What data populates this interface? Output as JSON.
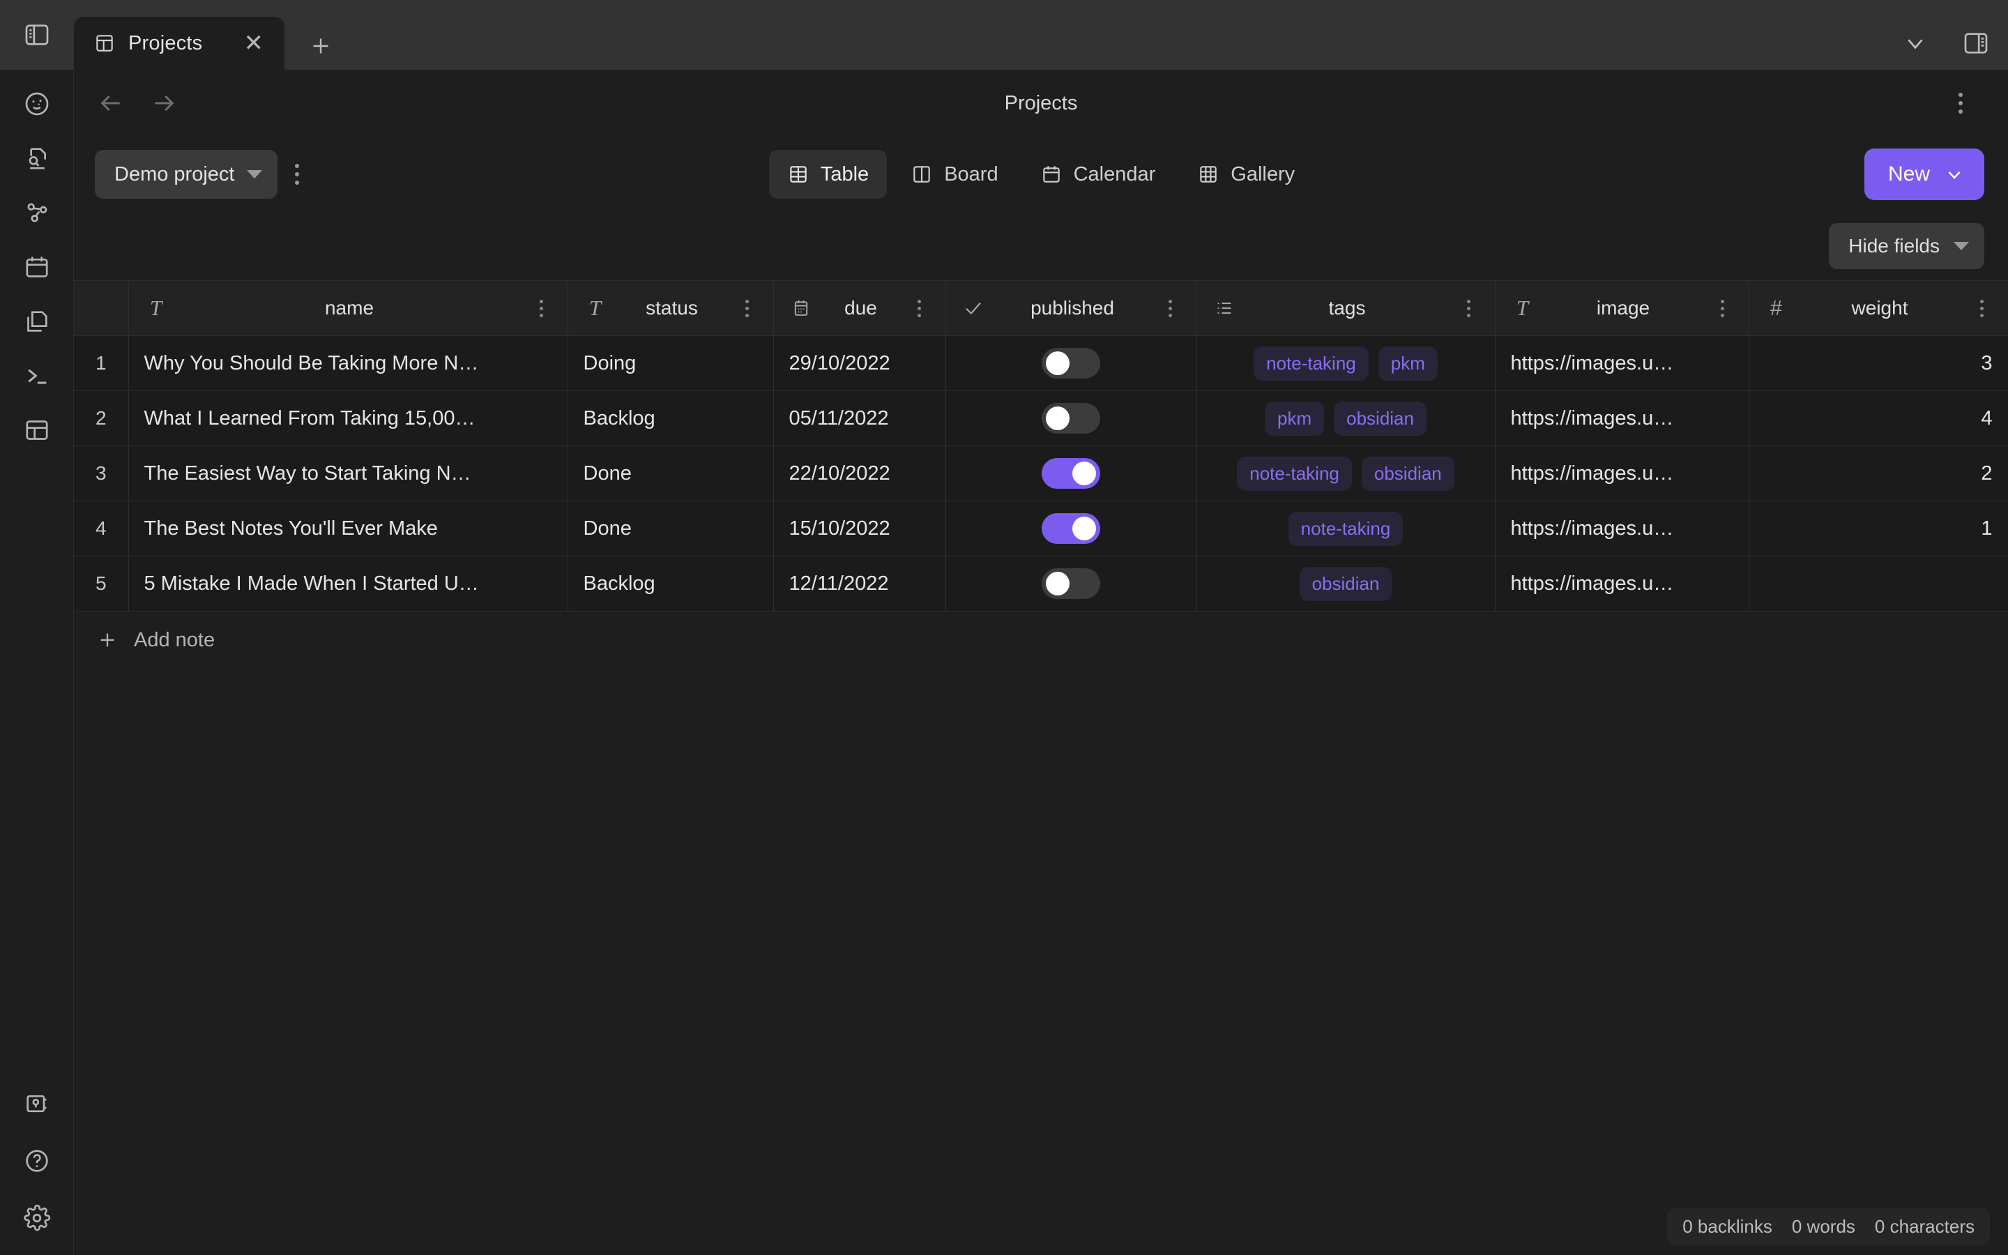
{
  "titlebar": {
    "sidebar_toggle_icon": "sidebar-left-icon",
    "tab": {
      "icon": "table-view-icon",
      "label": "Projects",
      "close_icon": "close-icon"
    },
    "new_tab_icon": "plus-icon",
    "chevron_icon": "chevron-down-icon",
    "right_sidebar_icon": "sidebar-right-icon"
  },
  "ribbon": {
    "top_items": [
      {
        "name": "sidebar-item-face",
        "icon": "smiley-face-icon"
      },
      {
        "name": "sidebar-item-search",
        "icon": "file-search-icon"
      },
      {
        "name": "sidebar-item-graph",
        "icon": "graph-nodes-icon"
      },
      {
        "name": "sidebar-item-calendar",
        "icon": "calendar-icon"
      },
      {
        "name": "sidebar-item-copy",
        "icon": "copy-files-icon"
      },
      {
        "name": "sidebar-item-terminal",
        "icon": "terminal-icon"
      },
      {
        "name": "sidebar-item-layout",
        "icon": "layout-panels-icon"
      }
    ],
    "bottom_items": [
      {
        "name": "sidebar-item-vault",
        "icon": "vault-icon"
      },
      {
        "name": "sidebar-item-help",
        "icon": "question-circle-icon"
      },
      {
        "name": "sidebar-item-settings",
        "icon": "gear-icon"
      }
    ]
  },
  "view_header": {
    "back_icon": "arrow-left-icon",
    "forward_icon": "arrow-right-icon",
    "title": "Projects",
    "more_icon": "kebab-vertical-icon"
  },
  "toolbar": {
    "project_label": "Demo project",
    "project_caret_icon": "caret-down-icon",
    "more_icon": "kebab-vertical-icon",
    "views": [
      {
        "label": "Table",
        "icon": "table-grid-icon",
        "active": true
      },
      {
        "label": "Board",
        "icon": "board-columns-icon",
        "active": false
      },
      {
        "label": "Calendar",
        "icon": "calendar-icon",
        "active": false
      },
      {
        "label": "Gallery",
        "icon": "gallery-grid-icon",
        "active": false
      }
    ],
    "new_label": "New",
    "new_chevron_icon": "chevron-down-icon",
    "new_button_color": "#7c5cf0"
  },
  "fieldbar": {
    "hide_fields_label": "Hide fields",
    "hide_fields_caret_icon": "caret-down-icon"
  },
  "table": {
    "columns": [
      {
        "key": "idx",
        "label": "",
        "type_icon": ""
      },
      {
        "key": "name",
        "label": "name",
        "type_icon": "text-type-icon"
      },
      {
        "key": "status",
        "label": "status",
        "type_icon": "text-type-icon"
      },
      {
        "key": "due",
        "label": "due",
        "type_icon": "calendar-type-icon"
      },
      {
        "key": "published",
        "label": "published",
        "type_icon": "checkbox-type-icon"
      },
      {
        "key": "tags",
        "label": "tags",
        "type_icon": "list-type-icon"
      },
      {
        "key": "image",
        "label": "image",
        "type_icon": "text-type-icon"
      },
      {
        "key": "weight",
        "label": "weight",
        "type_icon": "number-type-icon"
      }
    ],
    "rows": [
      {
        "idx": "1",
        "name": "Why You Should Be Taking More N…",
        "status": "Doing",
        "due": "29/10/2022",
        "published": false,
        "tags": [
          "note-taking",
          "pkm"
        ],
        "image": "https://images.u…",
        "weight": "3"
      },
      {
        "idx": "2",
        "name": "What I Learned From Taking 15,00…",
        "status": "Backlog",
        "due": "05/11/2022",
        "published": false,
        "tags": [
          "pkm",
          "obsidian"
        ],
        "image": "https://images.u…",
        "weight": "4"
      },
      {
        "idx": "3",
        "name": "The Easiest Way to Start Taking N…",
        "status": "Done",
        "due": "22/10/2022",
        "published": true,
        "tags": [
          "note-taking",
          "obsidian"
        ],
        "image": "https://images.u…",
        "weight": "2"
      },
      {
        "idx": "4",
        "name": "The Best Notes You'll Ever Make",
        "status": "Done",
        "due": "15/10/2022",
        "published": true,
        "tags": [
          "note-taking"
        ],
        "image": "https://images.u…",
        "weight": "1"
      },
      {
        "idx": "5",
        "name": "5 Mistake I Made When I Started U…",
        "status": "Backlog",
        "due": "12/11/2022",
        "published": false,
        "tags": [
          "obsidian"
        ],
        "image": "https://images.u…",
        "weight": ""
      }
    ],
    "add_row_label": "Add note",
    "add_row_icon": "plus-icon"
  },
  "statusbar": {
    "backlinks": "0 backlinks",
    "words": "0 words",
    "characters": "0 characters"
  },
  "colors": {
    "accent": "#7c5cf0",
    "tag_bg": "#282538",
    "tag_text": "#8a6ef0",
    "window_bg": "#1e1e1e",
    "titlebar_bg": "#333333",
    "header_row_bg": "#232323"
  }
}
